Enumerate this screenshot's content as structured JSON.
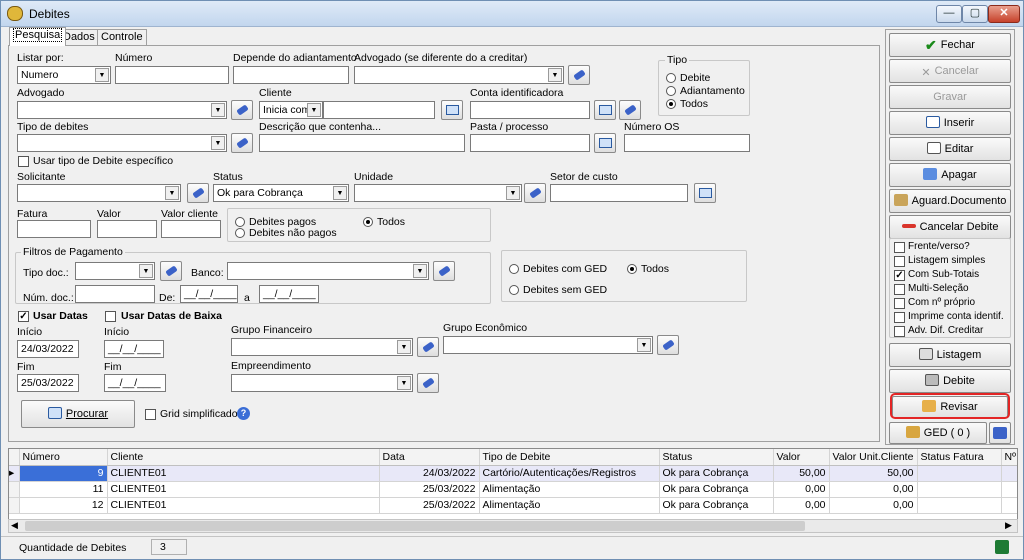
{
  "window": {
    "title": "Debites",
    "minimize": "—",
    "maximize": "▢",
    "close": "✕"
  },
  "tabs": [
    "Pesquisa",
    "Dados",
    "Controle"
  ],
  "form": {
    "listar_por": {
      "label": "Listar por:",
      "value": "Numero"
    },
    "numero": {
      "label": "Número",
      "value": ""
    },
    "depende": {
      "label": "Depende do adiantamento",
      "value": ""
    },
    "advogado_dif": {
      "label": "Advogado  (se diferente do a creditar)",
      "value": ""
    },
    "tipo": {
      "label": "Tipo",
      "options": [
        "Debite",
        "Adiantamento",
        "Todos"
      ],
      "selected": "Todos"
    },
    "advogado": {
      "label": "Advogado",
      "value": ""
    },
    "cliente": {
      "label": "Cliente",
      "mode": "Inicia com",
      "value": ""
    },
    "conta": {
      "label": "Conta identificadora",
      "value": ""
    },
    "tipo_debites": {
      "label": "Tipo de debites",
      "value": ""
    },
    "descricao": {
      "label": "Descrição que contenha...",
      "value": ""
    },
    "pasta": {
      "label": "Pasta / processo",
      "value": ""
    },
    "numero_os": {
      "label": "Número OS",
      "value": ""
    },
    "usar_tipo": {
      "label": "Usar tipo de Debite específico",
      "checked": false
    },
    "solicitante": {
      "label": "Solicitante",
      "value": ""
    },
    "status": {
      "label": "Status",
      "value": "Ok para Cobrança"
    },
    "unidade": {
      "label": "Unidade",
      "value": ""
    },
    "setor": {
      "label": "Setor de custo",
      "value": ""
    },
    "fatura": {
      "label": "Fatura",
      "value": ""
    },
    "valor": {
      "label": "Valor",
      "value": ""
    },
    "valor_cliente": {
      "label": "Valor cliente",
      "value": ""
    },
    "pagos": {
      "options": [
        "Debites pagos",
        "Debites não pagos",
        "Todos"
      ],
      "selected": "Todos"
    },
    "filtros": {
      "label": "Filtros de Pagamento",
      "tipo_doc": "Tipo doc.:",
      "banco": "Banco:",
      "num_doc": "Núm. doc.:",
      "de": "De:",
      "a": "a",
      "date_blank": "__/__/____"
    },
    "ged": {
      "options": [
        "Debites com GED",
        "Debites sem GED",
        "Todos"
      ],
      "selected": "Todos"
    },
    "usar_datas": {
      "label": "Usar Datas",
      "checked": true
    },
    "usar_baixa": {
      "label": "Usar Datas de Baixa",
      "checked": false
    },
    "inicio_label": "Início",
    "fim_label": "Fim",
    "inicio": "24/03/2022",
    "fim": "25/03/2022",
    "grupo_fin": {
      "label": "Grupo Financeiro",
      "value": ""
    },
    "grupo_eco": {
      "label": "Grupo Econômico",
      "value": ""
    },
    "empreendimento": {
      "label": "Empreendimento",
      "value": ""
    },
    "procurar": "Procurar",
    "grid_simpl": {
      "label": "Grid simplificado",
      "checked": false
    },
    "help": "?"
  },
  "actions": {
    "fechar": "Fechar",
    "cancelar": "Cancelar",
    "gravar": "Gravar",
    "inserir": "Inserir",
    "editar": "Editar",
    "apagar": "Apagar",
    "aguard": "Aguard.Documento",
    "cancelar_debite": "Cancelar Debite",
    "options": [
      {
        "label": "Frente/verso?",
        "checked": false
      },
      {
        "label": "Listagem simples",
        "checked": false
      },
      {
        "label": "Com Sub-Totais",
        "checked": true
      },
      {
        "label": "Multi-Seleção",
        "checked": false
      },
      {
        "label": "Com nº próprio",
        "checked": false
      },
      {
        "label": "Imprime conta identif.",
        "checked": false
      },
      {
        "label": "Adv. Dif. Creditar",
        "checked": false
      }
    ],
    "listagem": "Listagem",
    "debite": "Debite",
    "revisar": "Revisar",
    "ged": "GED ( 0 )"
  },
  "grid": {
    "columns": [
      "Número",
      "Cliente",
      "Data",
      "Tipo de Debite",
      "Status",
      "Valor",
      "Valor Unit.Cliente",
      "Status Fatura",
      "Nº"
    ],
    "rows": [
      [
        "9",
        "CLIENTE01",
        "24/03/2022",
        "Cartório/Autenticações/Registros",
        "Ok para Cobrança",
        "50,00",
        "50,00",
        "",
        ""
      ],
      [
        "11",
        "CLIENTE01",
        "25/03/2022",
        "Alimentação",
        "Ok para Cobrança",
        "0,00",
        "0,00",
        "",
        ""
      ],
      [
        "12",
        "CLIENTE01",
        "25/03/2022",
        "Alimentação",
        "Ok para Cobrança",
        "0,00",
        "0,00",
        "",
        ""
      ]
    ]
  },
  "status": {
    "label": "Quantidade de Debites",
    "count": "3"
  },
  "colors": {
    "accent": "#3a6fd8",
    "highlight": "#e32525",
    "title_bg": "#c2d6ee"
  }
}
